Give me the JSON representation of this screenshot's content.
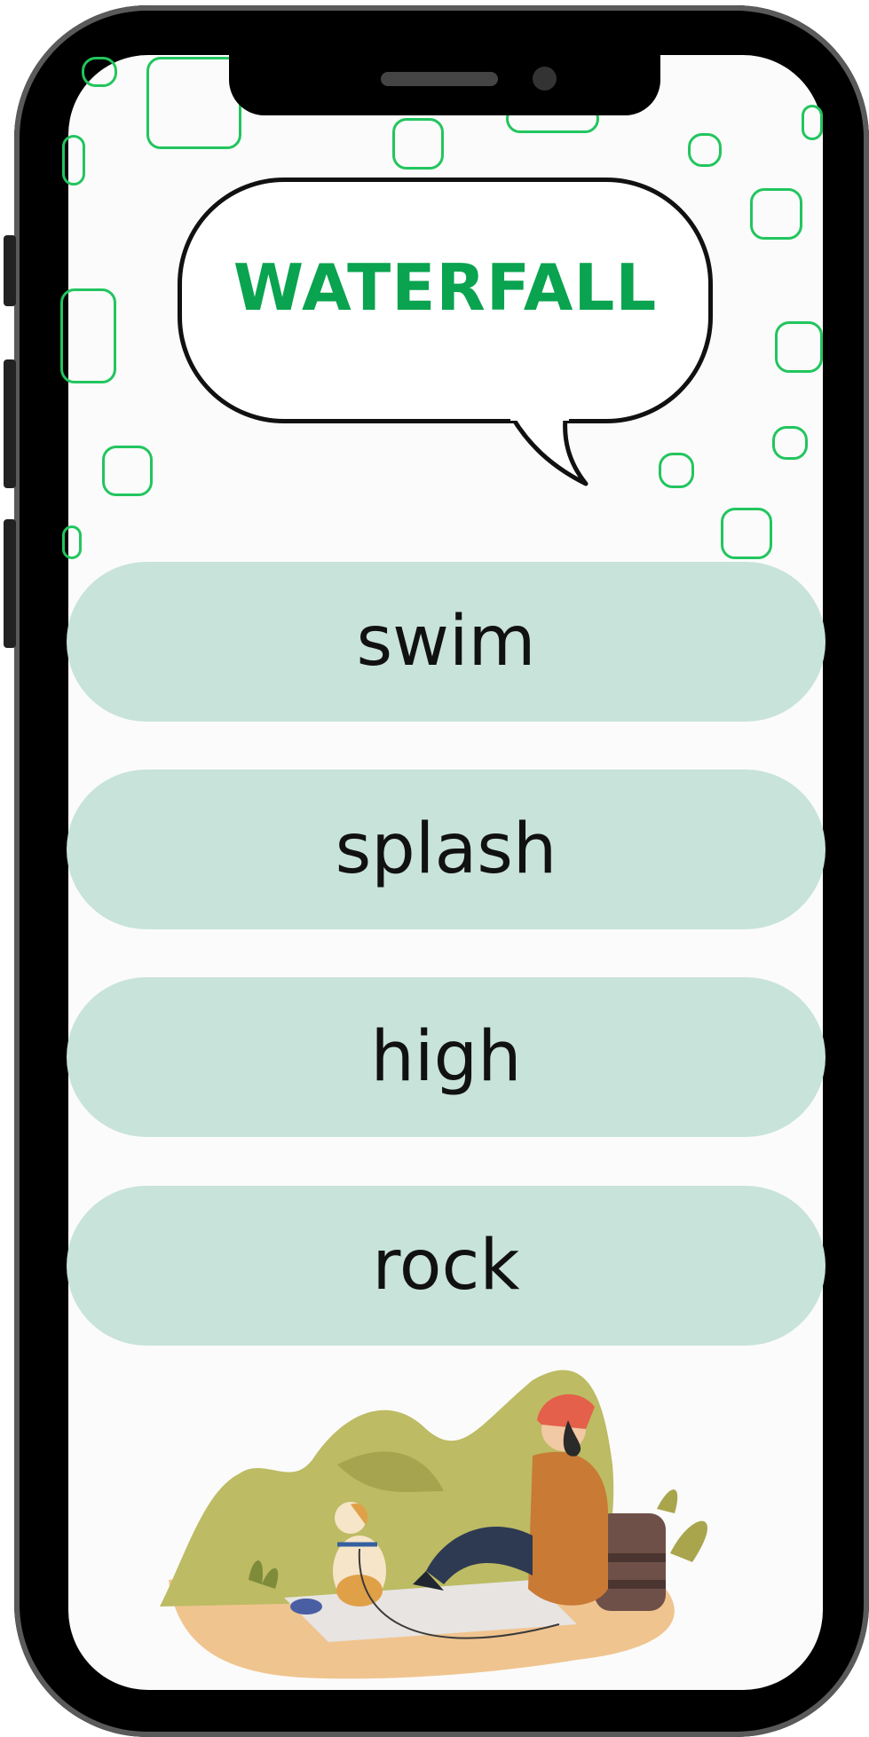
{
  "word_card": {
    "title": "WATERFALL"
  },
  "options": [
    {
      "label": "swim"
    },
    {
      "label": "splash"
    },
    {
      "label": "high"
    },
    {
      "label": "rock"
    }
  ],
  "colors": {
    "title": "#0aa34f",
    "option_bg": "#c8e3d9",
    "square_outline": "#22c55e",
    "phone_frame": "#000000"
  },
  "icons": {
    "illustration": "hiker-with-dog-illustration",
    "decoration": "rounded-square-outline"
  }
}
